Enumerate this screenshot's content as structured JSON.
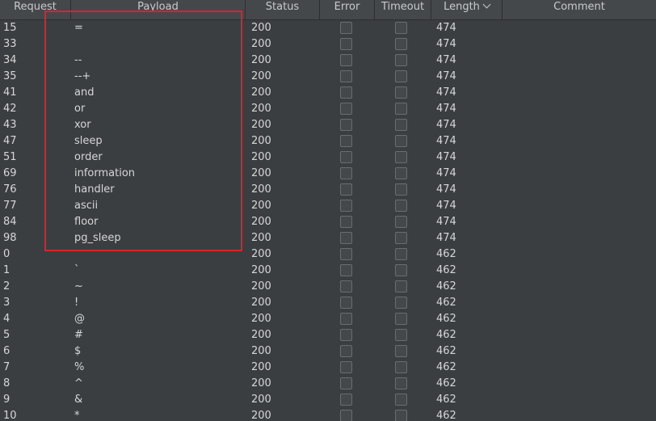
{
  "columns": {
    "request": "Request",
    "payload": "Payload",
    "status": "Status",
    "error": "Error",
    "timeout": "Timeout",
    "length": "Length",
    "comment": "Comment"
  },
  "rows": [
    {
      "request": "15",
      "payload": "=",
      "status": "200",
      "length": "474"
    },
    {
      "request": "33",
      "payload": "",
      "status": "200",
      "length": "474"
    },
    {
      "request": "34",
      "payload": "--",
      "status": "200",
      "length": "474"
    },
    {
      "request": "35",
      "payload": "--+",
      "status": "200",
      "length": "474"
    },
    {
      "request": "41",
      "payload": "and",
      "status": "200",
      "length": "474"
    },
    {
      "request": "42",
      "payload": "or",
      "status": "200",
      "length": "474"
    },
    {
      "request": "43",
      "payload": "xor",
      "status": "200",
      "length": "474"
    },
    {
      "request": "47",
      "payload": "sleep",
      "status": "200",
      "length": "474"
    },
    {
      "request": "51",
      "payload": "order",
      "status": "200",
      "length": "474"
    },
    {
      "request": "69",
      "payload": "information",
      "status": "200",
      "length": "474"
    },
    {
      "request": "76",
      "payload": "handler",
      "status": "200",
      "length": "474"
    },
    {
      "request": "77",
      "payload": "ascii",
      "status": "200",
      "length": "474"
    },
    {
      "request": "84",
      "payload": "floor",
      "status": "200",
      "length": "474"
    },
    {
      "request": "98",
      "payload": "pg_sleep",
      "status": "200",
      "length": "474"
    },
    {
      "request": "0",
      "payload": "",
      "status": "200",
      "length": "462"
    },
    {
      "request": "1",
      "payload": "`",
      "status": "200",
      "length": "462"
    },
    {
      "request": "2",
      "payload": "~",
      "status": "200",
      "length": "462"
    },
    {
      "request": "3",
      "payload": "!",
      "status": "200",
      "length": "462"
    },
    {
      "request": "4",
      "payload": "@",
      "status": "200",
      "length": "462"
    },
    {
      "request": "5",
      "payload": "#",
      "status": "200",
      "length": "462"
    },
    {
      "request": "6",
      "payload": "$",
      "status": "200",
      "length": "462"
    },
    {
      "request": "7",
      "payload": "%",
      "status": "200",
      "length": "462"
    },
    {
      "request": "8",
      "payload": "^",
      "status": "200",
      "length": "462"
    },
    {
      "request": "9",
      "payload": "&",
      "status": "200",
      "length": "462"
    },
    {
      "request": "10",
      "payload": "*",
      "status": "200",
      "length": "462"
    }
  ],
  "colors": {
    "background": "#3b3e41",
    "header": "#45484b",
    "highlight": "#d9232b"
  },
  "icons": {
    "sort": "chevron-down-icon"
  }
}
